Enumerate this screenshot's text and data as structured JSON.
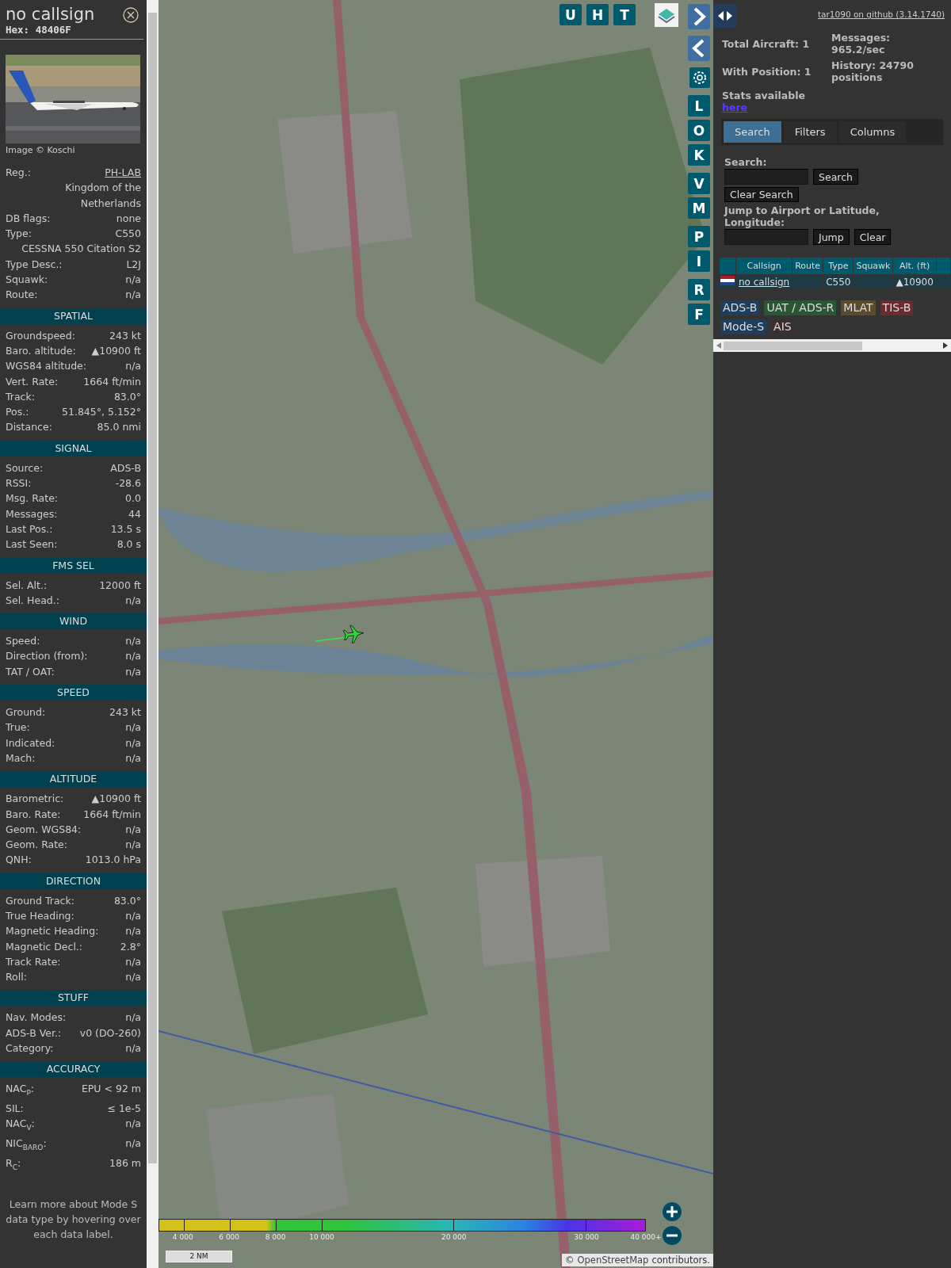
{
  "detail": {
    "title": "no callsign",
    "hex": "Hex: 48406F",
    "photo_credit": "Image © Koschi",
    "rows": [
      {
        "kind": "link",
        "label": "Reg.:",
        "value": "PH-LAB"
      },
      {
        "kind": "note",
        "value": "Kingdom of the Netherlands"
      },
      {
        "kind": "pair",
        "label": "DB flags:",
        "value": "none"
      },
      {
        "kind": "pair",
        "label": "Type:",
        "value": "C550"
      },
      {
        "kind": "note",
        "value": "CESSNA 550 Citation S2"
      },
      {
        "kind": "pair",
        "label": "Type Desc.:",
        "value": "L2J"
      },
      {
        "kind": "pair",
        "label": "Squawk:",
        "value": "n/a"
      },
      {
        "kind": "pair",
        "label": "Route:",
        "value": "n/a"
      }
    ],
    "sections": [
      {
        "title": "SPATIAL",
        "rows": [
          {
            "label": "Groundspeed:",
            "value": "243 kt"
          },
          {
            "label": "Baro. altitude:",
            "value": "▲10900 ft"
          },
          {
            "label": "WGS84 altitude:",
            "value": "n/a"
          },
          {
            "label": "Vert. Rate:",
            "value": "1664 ft/min"
          },
          {
            "label": "Track:",
            "value": "83.0°"
          },
          {
            "label": "Pos.:",
            "value": "51.845°, 5.152°"
          },
          {
            "label": "Distance:",
            "value": "85.0 nmi"
          }
        ]
      },
      {
        "title": "SIGNAL",
        "rows": [
          {
            "label": "Source:",
            "value": "ADS-B"
          },
          {
            "label": "RSSI:",
            "value": "-28.6"
          },
          {
            "label": "Msg. Rate:",
            "value": "0.0"
          },
          {
            "label": "Messages:",
            "value": "44"
          },
          {
            "label": "Last Pos.:",
            "value": "13.5 s"
          },
          {
            "label": "Last Seen:",
            "value": "8.0 s"
          }
        ]
      },
      {
        "title": "FMS SEL",
        "rows": [
          {
            "label": "Sel. Alt.:",
            "value": "12000 ft"
          },
          {
            "label": "Sel. Head.:",
            "value": "n/a"
          }
        ]
      },
      {
        "title": "WIND",
        "rows": [
          {
            "label": "Speed:",
            "value": "n/a"
          },
          {
            "label": "Direction (from):",
            "value": "n/a"
          },
          {
            "label": "TAT / OAT:",
            "value": "n/a"
          }
        ]
      },
      {
        "title": "SPEED",
        "rows": [
          {
            "label": "Ground:",
            "value": "243 kt"
          },
          {
            "label": "True:",
            "value": "n/a"
          },
          {
            "label": "Indicated:",
            "value": "n/a"
          },
          {
            "label": "Mach:",
            "value": "n/a"
          }
        ]
      },
      {
        "title": "ALTITUDE",
        "rows": [
          {
            "label": "Barometric:",
            "value": "▲10900 ft"
          },
          {
            "label": "Baro. Rate:",
            "value": "1664 ft/min"
          },
          {
            "label": "Geom. WGS84:",
            "value": "n/a"
          },
          {
            "label": "Geom. Rate:",
            "value": "n/a"
          },
          {
            "label": "QNH:",
            "value": "1013.0 hPa"
          }
        ]
      },
      {
        "title": "DIRECTION",
        "rows": [
          {
            "label": "Ground Track:",
            "value": "83.0°"
          },
          {
            "label": "True Heading:",
            "value": "n/a"
          },
          {
            "label": "Magnetic Heading:",
            "value": "n/a"
          },
          {
            "label": "Magnetic Decl.:",
            "value": "2.8°"
          },
          {
            "label": "Track Rate:",
            "value": "n/a"
          },
          {
            "label": "Roll:",
            "value": "n/a"
          }
        ]
      },
      {
        "title": "STUFF",
        "rows": [
          {
            "label": "Nav. Modes:",
            "value": "n/a"
          },
          {
            "label": "ADS-B Ver.:",
            "value": "v0 (DO-260)"
          },
          {
            "label": "Category:",
            "value": "n/a"
          }
        ]
      },
      {
        "title": "ACCURACY",
        "rows": [
          {
            "label": "NAC$_{P}$:",
            "value": "EPU < 92 m"
          },
          {
            "label": "SIL:",
            "value": "≤ 1e-5"
          },
          {
            "label": "NAC$_{V}$:",
            "value": "n/a"
          },
          {
            "label": "NIC$_{BARO}$:",
            "value": "n/a"
          },
          {
            "label": "R$_{C}$:",
            "value": "186 m"
          }
        ]
      }
    ],
    "footer": "Learn more about Mode S data type by hovering over each data label."
  },
  "map": {
    "top_buttons": [
      "U",
      "H",
      "T"
    ],
    "side_buttons": [
      [
        "L",
        "O",
        "K"
      ],
      [
        "V",
        "M"
      ],
      [
        "P",
        "I"
      ],
      [
        "R",
        "F"
      ]
    ],
    "legend_ticks": [
      "4 000",
      "6 000",
      "8 000",
      "10 000",
      "20 000",
      "30 000",
      "40 000+"
    ],
    "scale": "2 NM",
    "attribution_prefix": "©",
    "attribution_link": "OpenStreetMap",
    "attribution_suffix": "contributors."
  },
  "panel": {
    "github_link": "tar1090 on github (3.14.1740)",
    "stats_left": [
      "Total Aircraft: 1",
      "With Position: 1"
    ],
    "stats_right": [
      "Messages: 965.2/sec",
      "History: 24790 positions"
    ],
    "stats_text": "Stats available",
    "stats_link": "here",
    "tabs": [
      {
        "label": "Search",
        "selected": true
      },
      {
        "label": "Filters",
        "selected": false
      },
      {
        "label": "Columns",
        "selected": false
      }
    ],
    "search_label": "Search:",
    "search_button": "Search",
    "clear_search_button": "Clear Search",
    "jump_label": "Jump to Airport or Latitude, Longitude:",
    "jump_button": "Jump",
    "clear_button": "Clear",
    "table": {
      "columns": [
        "Callsign",
        "Route",
        "Type",
        "Squawk",
        "Alt. (ft)"
      ],
      "rows": [
        {
          "callsign": "no callsign",
          "route": "",
          "type": "C550",
          "squawk": "",
          "altitude": "▲10900"
        }
      ]
    },
    "sources": [
      {
        "label": "ADS-B",
        "color": "#1f3d5c"
      },
      {
        "label": "UAT / ADS-R",
        "color": "#2a5634"
      },
      {
        "label": "MLAT",
        "color": "#5a4b2a"
      },
      {
        "label": "TIS-B",
        "color": "#6a2a2e"
      },
      {
        "label": "Mode-S",
        "color": "#1f3d5c"
      },
      {
        "label": "AIS",
        "color": "#3a2e2e"
      }
    ]
  }
}
